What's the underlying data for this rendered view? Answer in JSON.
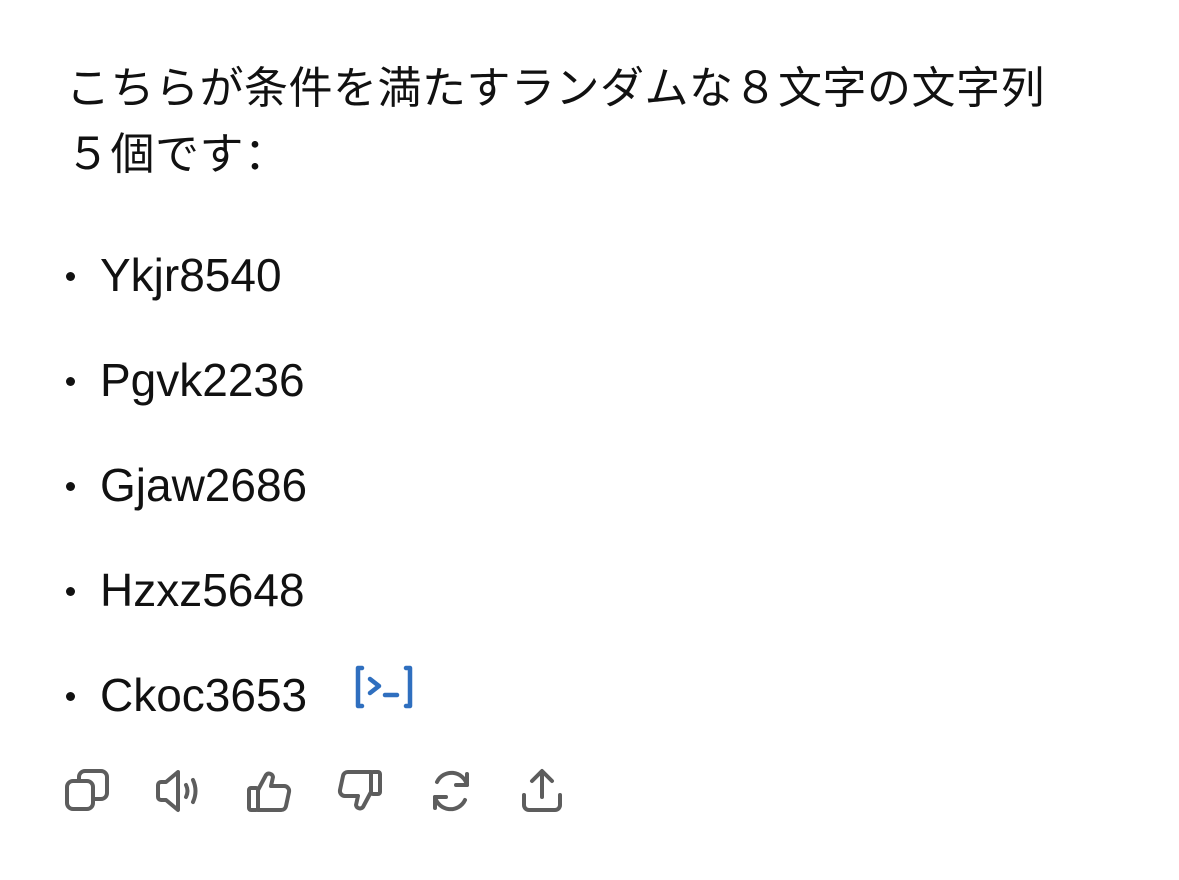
{
  "message": {
    "intro_line1": "こちらが条件を満たすランダムな８文字の文字列",
    "intro_line2": "５個です：",
    "items": [
      {
        "text": "Ykjr8540"
      },
      {
        "text": "Pgvk2236"
      },
      {
        "text": "Gjaw2686"
      },
      {
        "text": "Hzxz5648"
      },
      {
        "text": "Ckoc3653"
      }
    ],
    "code_badge_icon": "code-execution-icon",
    "accent_color": "#2f6fbf"
  },
  "toolbar": {
    "icons": [
      "copy-icon",
      "speaker-icon",
      "thumbs-up-icon",
      "thumbs-down-icon",
      "regenerate-icon",
      "share-icon"
    ],
    "icon_color": "#5d5d5d"
  }
}
